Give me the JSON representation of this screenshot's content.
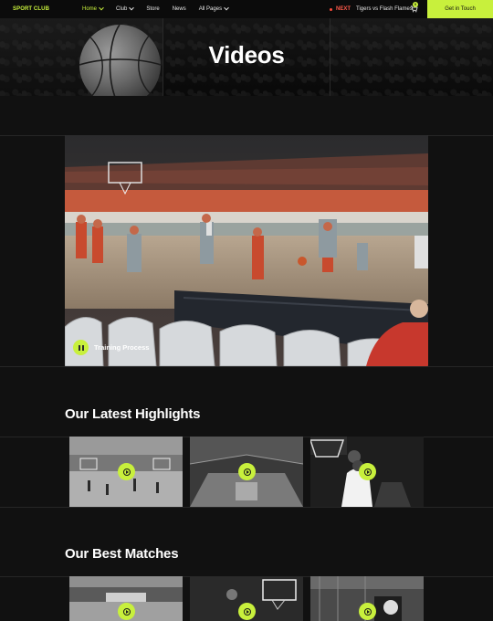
{
  "nav": {
    "logo": "SPORT CLUB",
    "menu": [
      {
        "label": "Home",
        "dropdown": true,
        "active": true
      },
      {
        "label": "Club",
        "dropdown": true,
        "active": false
      },
      {
        "label": "Store",
        "dropdown": false,
        "active": false
      },
      {
        "label": "News",
        "dropdown": false,
        "active": false
      },
      {
        "label": "All Pages",
        "dropdown": true,
        "active": false
      }
    ],
    "next_label": "NEXT",
    "next_match": "Tigers vs Flash Flames",
    "cart_count": "0",
    "cta_label": "Get in Touch"
  },
  "hero": {
    "title": "Videos"
  },
  "feature_video": {
    "label": "Training Process",
    "control_icon": "pause-icon"
  },
  "highlights": {
    "title": "Our Latest Highlights",
    "items": [
      {
        "icon": "play-icon"
      },
      {
        "icon": "play-icon"
      },
      {
        "icon": "play-icon"
      }
    ]
  },
  "matches": {
    "title": "Our Best Matches",
    "items": [
      {
        "icon": "play-icon"
      },
      {
        "icon": "play-icon"
      },
      {
        "icon": "play-icon"
      }
    ]
  },
  "colors": {
    "accent": "#c8f03c",
    "background": "#111111",
    "next_red": "#ff5a4a"
  }
}
